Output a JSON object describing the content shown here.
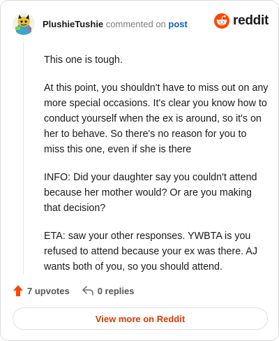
{
  "header": {
    "username": "PlushieTushie",
    "action_text": "commented on",
    "post_link": "post",
    "brand": "reddit"
  },
  "comment": {
    "paragraphs": [
      "This one is tough.",
      "At this point, you shouldn't have to miss out on any more special occasions. It's clear you know how to conduct yourself when the ex is around, so it's on her to behave. So there's no reason for you to miss this one, even if she is there",
      "INFO: Did your daughter say you couldn't attend because her mother would? Or are you making that decision?",
      "ETA: saw your other responses. YWBTA is you refused to attend because your ex was there. AJ wants both of you, so you should attend."
    ]
  },
  "actions": {
    "upvotes": "7 upvotes",
    "replies": "0 replies"
  },
  "footer": {
    "view_more": "View more on Reddit"
  },
  "colors": {
    "accent": "#d93a00",
    "upvote": "#ff4500",
    "link": "#0b5fbf"
  },
  "icons": {
    "avatar": "snoo-avatar-icon",
    "brand": "reddit-logo-icon",
    "upvote": "upvote-arrow-icon",
    "reply": "reply-arrow-icon"
  }
}
